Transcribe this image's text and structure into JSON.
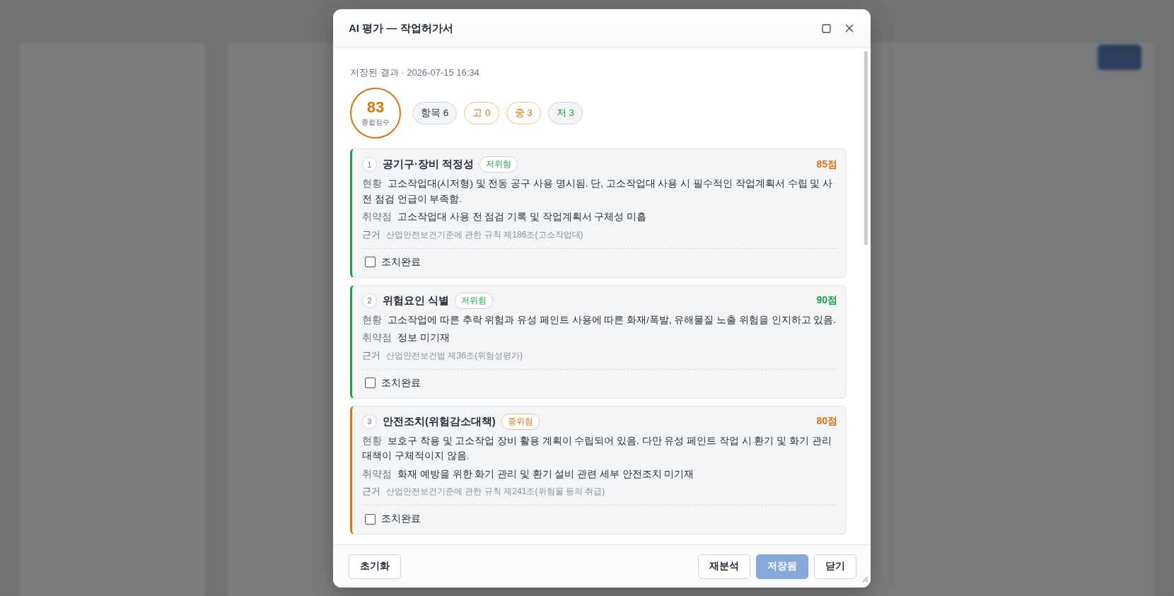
{
  "dialog": {
    "title": "AI 평가 — 작업허가서",
    "saved_info": "저장된 결과 · 2026-07-15 16:34",
    "score": {
      "value": "83",
      "label": "종합점수",
      "color": "#d9730d"
    },
    "summary_chips": [
      {
        "label": "항목 6",
        "kind": "total"
      },
      {
        "label": "고 0",
        "kind": "high"
      },
      {
        "label": "중 3",
        "kind": "medium"
      },
      {
        "label": "저 3",
        "kind": "low"
      }
    ],
    "items": [
      {
        "number": "1",
        "title": "공기구·장비 적정성",
        "risk_badge": "저위험",
        "kind": "low",
        "score": {
          "text": "85점",
          "color": "#d9730d"
        },
        "rows": [
          {
            "kind": "main",
            "label": "현황",
            "text": "고소작업대(시저형) 및 전동 공구 사용 명시됨. 단, 고소작업대 사용 시 필수적인 작업계획서 수립 및 사전 점검 언급이 부족함."
          },
          {
            "kind": "main",
            "label": "취약점",
            "text": "고소작업대 사용 전 점검 기록 및 작업계획서 구체성 미흡"
          },
          {
            "kind": "basis",
            "label": "근거",
            "text": "산업안전보건기준에 관한 규칙 제186조(고소작업대)"
          }
        ],
        "action": {
          "label": "조치완료",
          "checked": false
        }
      },
      {
        "number": "2",
        "title": "위험요인 식별",
        "risk_badge": "저위험",
        "kind": "low",
        "score": {
          "text": "90점",
          "color": "#1e9e4a"
        },
        "rows": [
          {
            "kind": "main",
            "label": "현황",
            "text": "고소작업에 따른 추락 위험과 유성 페인트 사용에 따른 화재/폭발, 유해물질 노출 위험을 인지하고 있음."
          },
          {
            "kind": "main",
            "label": "취약점",
            "text": "정보 미기재"
          },
          {
            "kind": "basis",
            "label": "근거",
            "text": "산업안전보건법 제36조(위험성평가)"
          }
        ],
        "action": {
          "label": "조치완료",
          "checked": false
        }
      },
      {
        "number": "3",
        "title": "안전조치(위험감소대책)",
        "risk_badge": "중위험",
        "kind": "medium",
        "score": {
          "text": "80점",
          "color": "#d9730d"
        },
        "rows": [
          {
            "kind": "main",
            "label": "현황",
            "text": "보호구 착용 및 고소작업 장비 활용 계획이 수립되어 있음. 다만 유성 페인트 작업 시 환기 및 화기 관리 대책이 구체적이지 않음."
          },
          {
            "kind": "main",
            "label": "취약점",
            "text": "화재 예방을 위한 화기 관리 및 환기 설비 관련 세부 안전조치 미기재"
          },
          {
            "kind": "basis",
            "label": "근거",
            "text": "산업안전보건기준에 관한 규칙 제241조(위험물 등의 취급)"
          }
        ],
        "action": {
          "label": "조치완료",
          "checked": false
        }
      }
    ],
    "footer": {
      "left_buttons": [
        {
          "label": "초기화",
          "kind": "default",
          "disabled": false
        }
      ],
      "right_buttons": [
        {
          "label": "재분석",
          "kind": "default",
          "disabled": false
        },
        {
          "label": "저장됨",
          "kind": "primary",
          "disabled": true
        },
        {
          "label": "닫기",
          "kind": "default",
          "disabled": false
        }
      ]
    }
  }
}
